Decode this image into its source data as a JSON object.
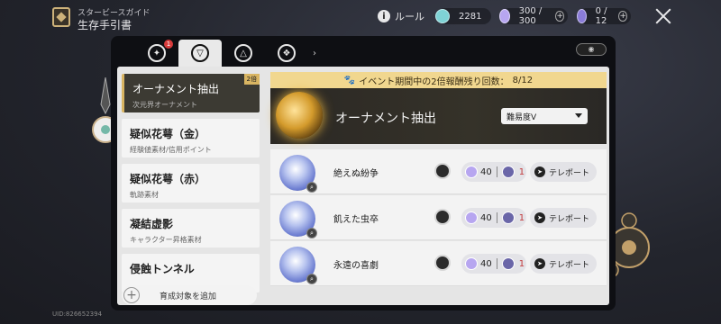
{
  "header": {
    "guide_subtitle": "スタービースガイド",
    "guide_title": "生存手引書",
    "rule_label": "ルール",
    "resources": [
      {
        "icon": "stellar-jade-icon",
        "value": "2281",
        "color": "#7fd3d6"
      },
      {
        "icon": "trailblaze-power-icon",
        "value": "300 / 300",
        "color": "#b7a6f0"
      },
      {
        "icon": "fuel-icon",
        "value": "0 / 12",
        "color": "#8b7cd8"
      }
    ]
  },
  "tabs": [
    {
      "icon": "tab-icon-1",
      "badge": "1"
    },
    {
      "icon": "tab-icon-2"
    },
    {
      "icon": "tab-icon-3"
    },
    {
      "icon": "tab-icon-4"
    }
  ],
  "sidebar": {
    "items": [
      {
        "title": "オーナメント抽出",
        "subtitle": "次元界オーナメント",
        "tag": "2倍"
      },
      {
        "title": "疑似花萼（金）",
        "subtitle": "経験値素材/信用ポイント"
      },
      {
        "title": "疑似花萼（赤）",
        "subtitle": "軌跡素材"
      },
      {
        "title": "凝結虚影",
        "subtitle": "キャラクター昇格素材"
      },
      {
        "title": "侵蝕トンネル",
        "subtitle": ""
      }
    ],
    "add_label": "育成対象を追加"
  },
  "banner": {
    "text": "イベント期間中の2倍報酬残り回数：",
    "count": "8/12"
  },
  "hero": {
    "title": "オーナメント抽出",
    "difficulty": "難易度V"
  },
  "rows": [
    {
      "name": "絶えぬ紛争",
      "cost": "40",
      "fuel": "1",
      "action": "テレポート"
    },
    {
      "name": "飢えた虫卒",
      "cost": "40",
      "fuel": "1",
      "action": "テレポート"
    },
    {
      "name": "永遠の喜劇",
      "cost": "40",
      "fuel": "1",
      "action": "テレポート"
    }
  ],
  "uid": "UID:826652394",
  "colors": {
    "accent": "#d9b562",
    "banner": "#f1d78f",
    "panel": "#0e0f13"
  }
}
